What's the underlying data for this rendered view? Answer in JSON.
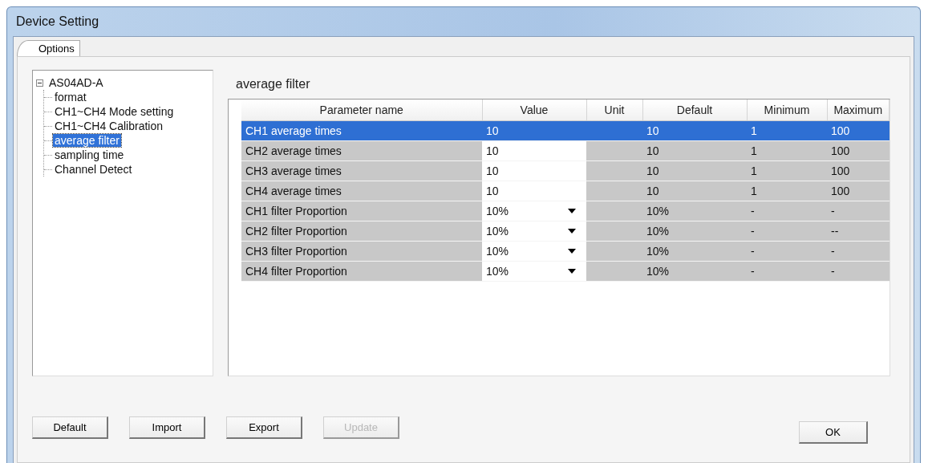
{
  "window": {
    "title": "Device Setting"
  },
  "tabs": [
    {
      "label": "Options",
      "selected": true
    }
  ],
  "tree": {
    "label": "AS04AD-A",
    "expanded": true,
    "children": [
      {
        "label": "format",
        "selected": false
      },
      {
        "label": "CH1~CH4 Mode setting",
        "selected": false
      },
      {
        "label": "CH1~CH4 Calibration",
        "selected": false
      },
      {
        "label": "average filter",
        "selected": true
      },
      {
        "label": "sampling time",
        "selected": false
      },
      {
        "label": "Channel Detect",
        "selected": false
      }
    ]
  },
  "section_title": "average filter",
  "table": {
    "columns": [
      "Parameter name",
      "Value",
      "Unit",
      "Default",
      "Minimum",
      "Maximum"
    ],
    "rows": [
      {
        "name": "CH1 average times",
        "kind": "text",
        "value": "10",
        "default": "10",
        "minimum": "1",
        "maximum": "100",
        "selected": true
      },
      {
        "name": "CH2 average times",
        "kind": "text",
        "value": "10",
        "default": "10",
        "minimum": "1",
        "maximum": "100",
        "selected": false
      },
      {
        "name": "CH3 average times",
        "kind": "text",
        "value": "10",
        "default": "10",
        "minimum": "1",
        "maximum": "100",
        "selected": false
      },
      {
        "name": "CH4 average times",
        "kind": "text",
        "value": "10",
        "default": "10",
        "minimum": "1",
        "maximum": "100",
        "selected": false
      },
      {
        "name": "CH1 filter Proportion",
        "kind": "dropdown",
        "value": "10%",
        "default": "10%",
        "minimum": "-",
        "maximum": "-",
        "selected": false
      },
      {
        "name": "CH2 filter Proportion",
        "kind": "dropdown",
        "value": "10%",
        "default": "10%",
        "minimum": "-",
        "maximum": "--",
        "selected": false
      },
      {
        "name": "CH3 filter Proportion",
        "kind": "dropdown",
        "value": "10%",
        "default": "10%",
        "minimum": "-",
        "maximum": "-",
        "selected": false
      },
      {
        "name": "CH4 filter Proportion",
        "kind": "dropdown",
        "value": "10%",
        "default": "10%",
        "minimum": "-",
        "maximum": "-",
        "selected": false
      }
    ]
  },
  "buttons": [
    {
      "label": "Default",
      "disabled": false
    },
    {
      "label": "Import",
      "disabled": false
    },
    {
      "label": "Export",
      "disabled": false
    },
    {
      "label": "Update",
      "disabled": true
    }
  ],
  "ok_button": {
    "label": "OK"
  }
}
